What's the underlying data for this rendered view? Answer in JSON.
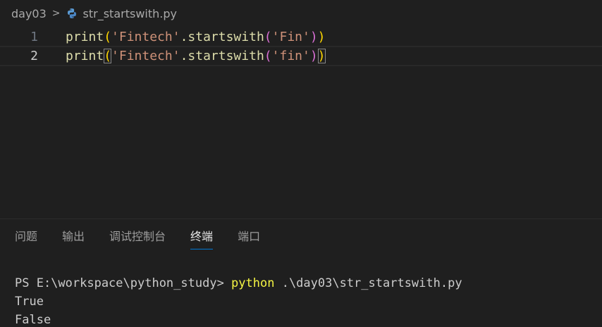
{
  "breadcrumb": {
    "folder": "day03",
    "separator": ">",
    "file": "str_startswith.py",
    "file_icon": "python-icon"
  },
  "editor": {
    "lines": [
      {
        "number": "1",
        "tokens": {
          "fn": "print",
          "open1": "(",
          "str1": "'Fintech'",
          "method": ".startswith",
          "open2": "(",
          "str2": "'Fin'",
          "close2": ")",
          "close1": ")"
        }
      },
      {
        "number": "2",
        "tokens": {
          "fn": "print",
          "open1": "(",
          "str1": "'Fintech'",
          "method": ".startswith",
          "open2": "(",
          "str2": "'fin'",
          "close2": ")",
          "close1": ")"
        }
      }
    ]
  },
  "panel": {
    "tabs": [
      {
        "label": "问题"
      },
      {
        "label": "输出"
      },
      {
        "label": "调试控制台"
      },
      {
        "label": "终端"
      },
      {
        "label": "端口"
      }
    ],
    "active_tab": "终端"
  },
  "terminal": {
    "prompt": "PS E:\\workspace\\python_study> ",
    "command": "python",
    "args": " .\\day03\\str_startswith.py",
    "output": [
      "True",
      "False"
    ]
  },
  "colors": {
    "background": "#1f1f1f",
    "function": "#dcdcaa",
    "bracket_level1": "#ffd700",
    "bracket_level2": "#da70d6",
    "string": "#ce9178",
    "terminal_command": "#f5f543",
    "active_tab_underline": "#0078d4"
  }
}
